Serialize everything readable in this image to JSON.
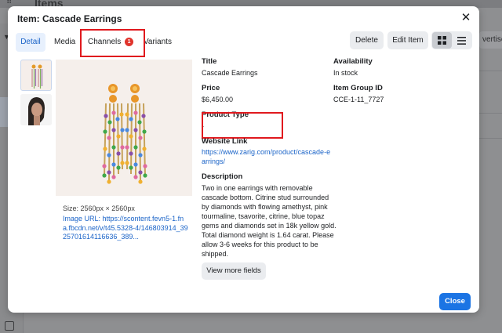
{
  "background": {
    "page_title": "Items",
    "right_button_partial": "vertise S"
  },
  "modal": {
    "title": "Item: Cascade Earrings",
    "close_icon": "close-icon"
  },
  "tabs": [
    {
      "label": "Detail",
      "active": true
    },
    {
      "label": "Media",
      "active": false
    },
    {
      "label": "Channels",
      "active": false,
      "badge": "1"
    },
    {
      "label": "Variants",
      "active": false
    }
  ],
  "toolbar": {
    "delete_label": "Delete",
    "edit_label": "Edit Item",
    "view_grid_icon": "grid-view-icon",
    "view_list_icon": "list-view-icon"
  },
  "image": {
    "size_text": "Size: 2560px × 2560px",
    "url_text": "Image URL: https://scontent.fevn5-1.fna.fbcdn.net/v/t45.5328-4/146803914_3925701614116636_389..."
  },
  "fields": {
    "title_label": "Title",
    "title_value": "Cascade Earrings",
    "price_label": "Price",
    "price_value": "$6,450.00",
    "product_type_label": "Product Type",
    "product_type_value": "-",
    "website_label": "Website Link",
    "website_value": "https://www.zarig.com/product/cascade-earrings/",
    "description_label": "Description",
    "description_value": "Two in one earrings with removable cascade bottom. Citrine stud surrounded by diamonds with flowing amethyst, pink tourmaline, tsavorite, citrine, blue topaz gems and diamonds set in 18k yellow gold. Total diamond weight is 1.64 carat. Please allow 3-6 weeks for this product to be shipped.",
    "availability_label": "Availability",
    "availability_value": "In stock",
    "group_id_label": "Item Group ID",
    "group_id_value": "CCE-1-11_7727"
  },
  "buttons": {
    "view_more_label": "View more fields",
    "close_label": "Close"
  },
  "colors": {
    "accent": "#1b74e4",
    "highlight": "#e0191e",
    "badge": "#e0342c"
  }
}
